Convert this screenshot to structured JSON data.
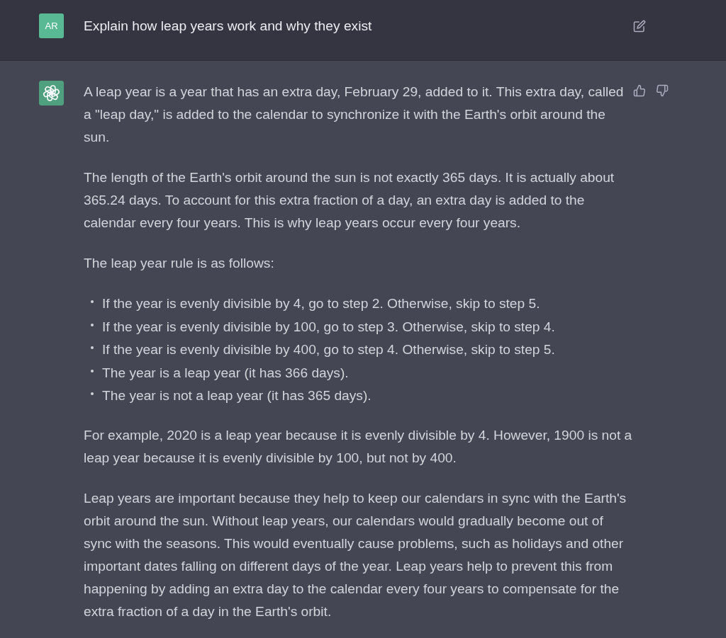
{
  "user_message": {
    "avatar_initials": "AR",
    "text": "Explain how leap years work and why they exist"
  },
  "assistant_message": {
    "blocks": [
      {
        "kind": "paragraph",
        "text": "A leap year is a year that has an extra day, February 29, added to it. This extra day, called a \"leap day,\" is added to the calendar to synchronize it with the Earth's orbit around the sun."
      },
      {
        "kind": "paragraph",
        "text": "The length of the Earth's orbit around the sun is not exactly 365 days. It is actually about 365.24 days. To account for this extra fraction of a day, an extra day is added to the calendar every four years. This is why leap years occur every four years."
      },
      {
        "kind": "paragraph",
        "text": "The leap year rule is as follows:"
      },
      {
        "kind": "list",
        "items": [
          "If the year is evenly divisible by 4, go to step 2. Otherwise, skip to step 5.",
          "If the year is evenly divisible by 100, go to step 3. Otherwise, skip to step 4.",
          "If the year is evenly divisible by 400, go to step 4. Otherwise, skip to step 5.",
          "The year is a leap year (it has 366 days).",
          "The year is not a leap year (it has 365 days)."
        ]
      },
      {
        "kind": "paragraph",
        "text": "For example, 2020 is a leap year because it is evenly divisible by 4. However, 1900 is not a leap year because it is evenly divisible by 100, but not by 400."
      },
      {
        "kind": "paragraph",
        "text": "Leap years are important because they help to keep our calendars in sync with the Earth's orbit around the sun. Without leap years, our calendars would gradually become out of sync with the seasons. This would eventually cause problems, such as holidays and other important dates falling on different days of the year. Leap years help to prevent this from happening by adding an extra day to the calendar every four years to compensate for the extra fraction of a day in the Earth's orbit."
      }
    ]
  }
}
